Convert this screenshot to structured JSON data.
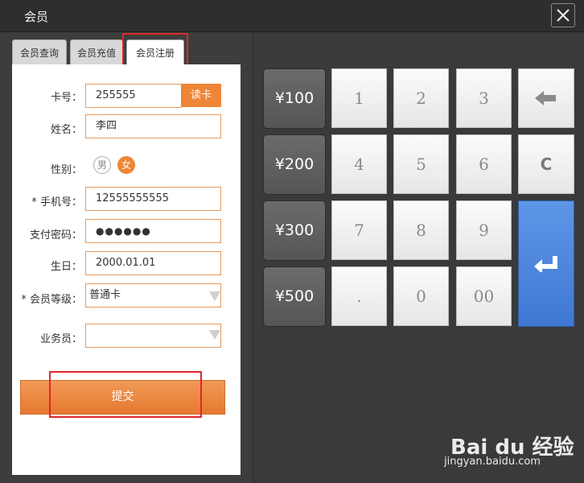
{
  "window": {
    "title": "会员"
  },
  "tabs": [
    {
      "label": "会员查询"
    },
    {
      "label": "会员充值"
    },
    {
      "label": "会员注册"
    }
  ],
  "form": {
    "card_label": "卡号：",
    "card_value": "255555",
    "read_card_button": "读卡",
    "name_label": "姓名：",
    "name_value": "李四",
    "gender_label": "性别：",
    "gender_male": "男",
    "gender_female": "女",
    "phone_label": "* 手机号：",
    "phone_value": "12555555555",
    "password_label": "支付密码：",
    "password_value": "●●●●●●",
    "birthday_label": "生日：",
    "birthday_value": "2000.01.01",
    "level_label": "* 会员等级：",
    "level_value": "普通卡",
    "staff_label": "业务员：",
    "staff_value": "",
    "submit_label": "提交"
  },
  "keypad": {
    "amounts": [
      "¥100",
      "¥200",
      "¥300",
      "¥500"
    ],
    "keys": [
      "1",
      "2",
      "3",
      "4",
      "5",
      "6",
      "7",
      "8",
      "9",
      ".",
      "0",
      "00"
    ],
    "clear": "C"
  },
  "watermark": {
    "brand": "Bai du 经验",
    "url": "jingyan.baidu.com"
  },
  "colors": {
    "accent": "#ee8537",
    "enter": "#4a86dd",
    "highlight": "#e0262c"
  }
}
